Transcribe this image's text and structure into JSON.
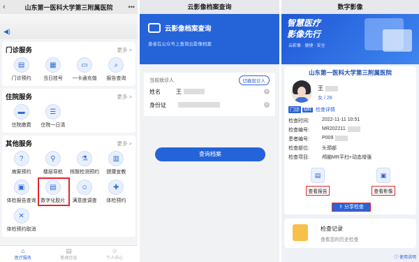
{
  "panel1": {
    "back_icon": "chevron-left-icon",
    "title": "山东第一医科大学第三附属医院",
    "more_icon": "more-dots-icon",
    "speaker_icon": "speaker-icon",
    "more_label": "更多 >",
    "outpatient": {
      "title": "门诊服务",
      "items": [
        {
          "label": "门诊预约",
          "icon": "clipboard-icon"
        },
        {
          "label": "当日挂号",
          "icon": "calendar-icon"
        },
        {
          "label": "一卡通充值",
          "icon": "card-icon"
        },
        {
          "label": "报告查询",
          "icon": "search-icon"
        }
      ]
    },
    "inpatient": {
      "title": "住院服务",
      "items": [
        {
          "label": "住院缴费",
          "icon": "bed-icon"
        },
        {
          "label": "住院一日清",
          "icon": "list-icon"
        }
      ]
    },
    "other": {
      "title": "其他服务",
      "items": [
        {
          "label": "病案预约",
          "icon": "question-icon"
        },
        {
          "label": "楼层导航",
          "icon": "map-pin-icon"
        },
        {
          "label": "核酸检测预约",
          "icon": "tube-icon"
        },
        {
          "label": "健康宣教",
          "icon": "book-icon"
        },
        {
          "label": "体检报告查询",
          "icon": "report-icon"
        },
        {
          "label": "数字化胶片",
          "icon": "film-icon"
        },
        {
          "label": "满意度调查",
          "icon": "smile-icon"
        },
        {
          "label": "体检预约",
          "icon": "checkup-icon"
        },
        {
          "label": "体检预约取消",
          "icon": "cancel-icon"
        }
      ]
    },
    "tabs": [
      {
        "label": "医疗服务",
        "icon": "home-icon"
      },
      {
        "label": "新闻信息",
        "icon": "news-icon"
      },
      {
        "label": "个人中心",
        "icon": "user-icon"
      }
    ]
  },
  "panel2": {
    "title": "云影像档案查询",
    "banner_title": "云影像档案查询",
    "banner_sub": "患者在公众号上查询云影像档案",
    "current_label": "当前就诊人",
    "switch_label": "切换就诊人",
    "name_label": "姓名",
    "name_value": "王",
    "id_label": "身份证",
    "query_button": "查询档案"
  },
  "panel3": {
    "title": "数字影像",
    "banner_line1": "智慧医疗",
    "banner_line2": "影像先行",
    "banner_line3": "云影像 · 便捷 · 安全",
    "hospital": "山东第一医科大学第三附属医院",
    "patient_name": "王",
    "patient_info": "女 / 28",
    "tag_dept": "门诊",
    "tag_type": "MR",
    "detail_link": "检查详情",
    "fields": [
      {
        "k": "检查时间:",
        "v": "2022-11-11 10:51"
      },
      {
        "k": "检查编号:",
        "v": "MR202211"
      },
      {
        "k": "患者编号:",
        "v": "P009"
      },
      {
        "k": "检查部位:",
        "v": "头颈部"
      },
      {
        "k": "检查项目:",
        "v": "颅脑MR平扫+动态增强"
      }
    ],
    "view_report": "查看报告",
    "view_image": "查看影像",
    "share": "分享检查",
    "history_title": "检查记录",
    "history_sub": "查看您的历史检查",
    "manual": "使用说明"
  }
}
